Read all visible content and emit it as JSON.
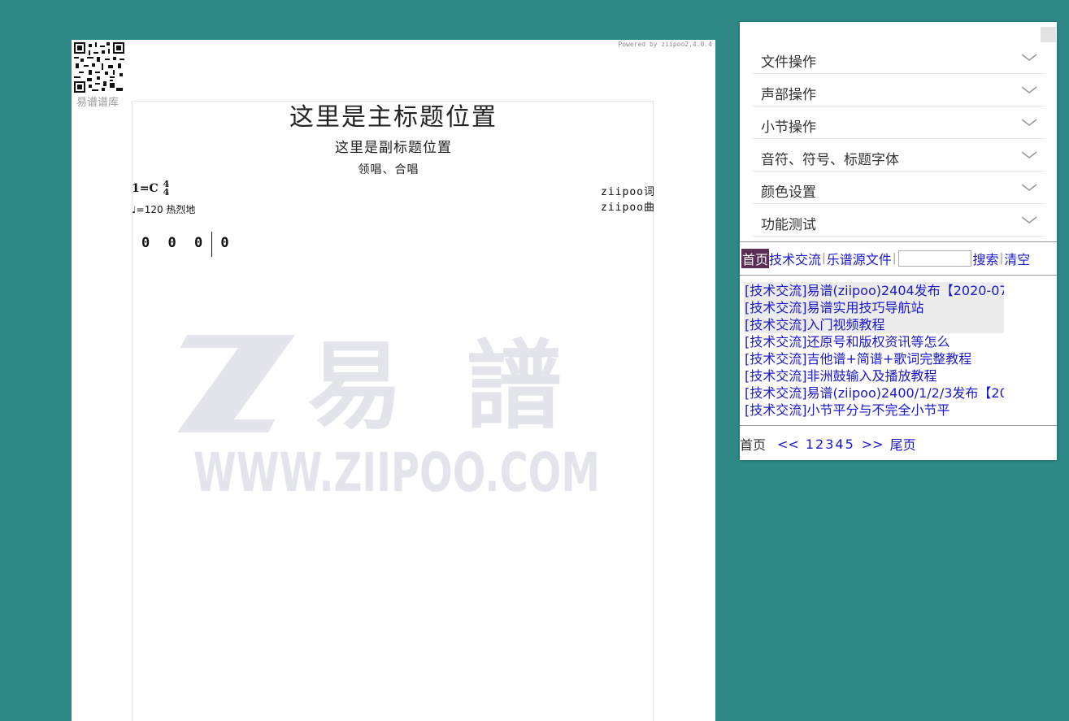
{
  "sheet": {
    "powered_by": "Powered by ziipoo2.4.0.4",
    "qr_label": "易谱谱库",
    "main_title": "这里是主标题位置",
    "sub_title": "这里是副标题位置",
    "singer": "领唱、合唱",
    "key": "1=C",
    "time_sig_top": "4",
    "time_sig_bottom": "4",
    "tempo": "♩=120 热烈地",
    "lyricist": "ziipoo词",
    "composer": "ziipoo曲",
    "notes": "0 0 0 0",
    "watermark_brand": "易 譜",
    "watermark_url": "WWW.ZIIPOO.COM"
  },
  "panel": {
    "menu": [
      {
        "label": "文件操作"
      },
      {
        "label": "声部操作"
      },
      {
        "label": "小节操作"
      },
      {
        "label": "音符、符号、标题字体"
      },
      {
        "label": "颜色设置"
      },
      {
        "label": "功能测试"
      }
    ],
    "nav": {
      "home": "首页",
      "tech": "技术交流",
      "source": "乐谱源文件",
      "search_value": "",
      "search": "搜索",
      "clear": "清空"
    },
    "posts": [
      "[技术交流]易谱(ziipoo)2404发布【2020-07-",
      "[技术交流]易谱实用技巧导航站",
      "[技术交流]入门视频教程",
      "[技术交流]还原号和版权资讯等怎么",
      "[技术交流]吉他谱+简谱+歌词完整教程",
      "[技术交流]非洲鼓输入及播放教程",
      "[技术交流]易谱(ziipoo)2400/1/2/3发布【20",
      "[技术交流]小节平分与不完全小节平"
    ],
    "pager": {
      "first": "首页",
      "prev": "<<",
      "pages": [
        "1",
        "2",
        "3",
        "4",
        "5"
      ],
      "next": ">>",
      "last": "尾页"
    }
  },
  "colors": {
    "background": "#2e8986",
    "link": "#1a18c8",
    "active_tab": "#5a2e55",
    "watermark": "#e4e4ec"
  }
}
